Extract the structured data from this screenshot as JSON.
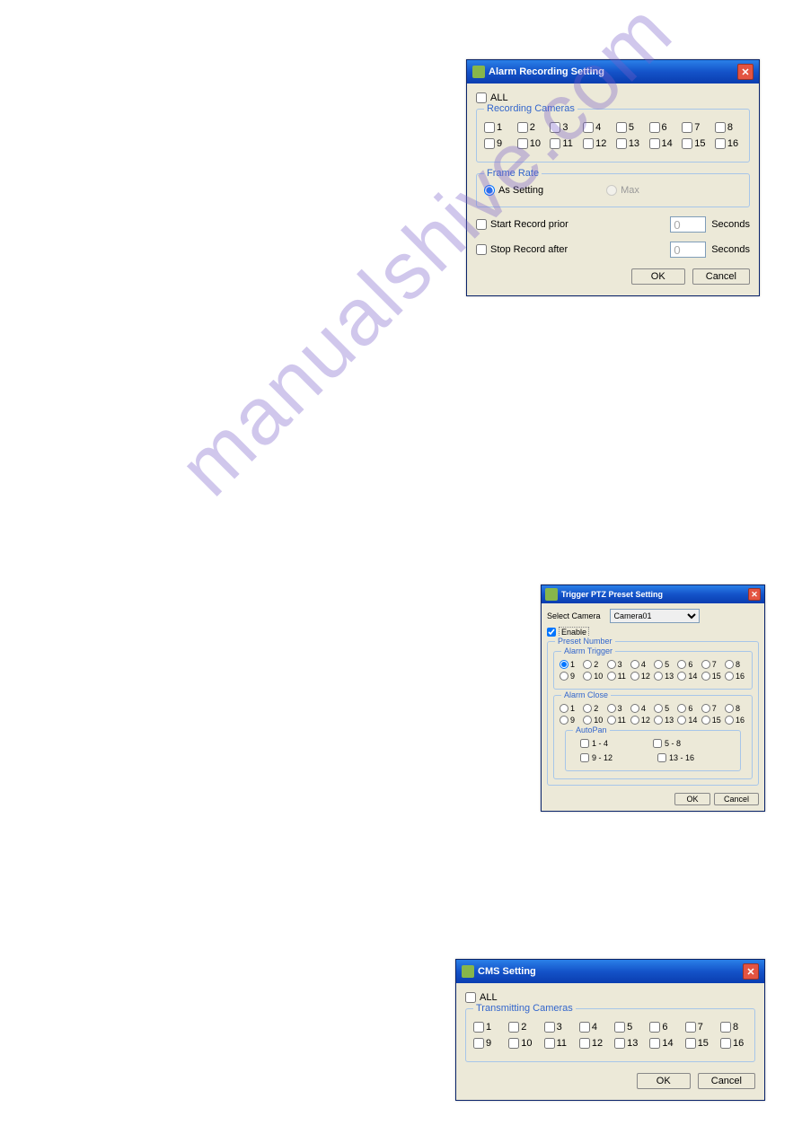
{
  "watermark": "manualshive.com",
  "dialog1": {
    "title": "Alarm Recording Setting",
    "all_label": "ALL",
    "fs_recording": "Recording Cameras",
    "cameras1": [
      "1",
      "2",
      "3",
      "4",
      "5",
      "6",
      "7",
      "8"
    ],
    "cameras2": [
      "9",
      "10",
      "11",
      "12",
      "13",
      "14",
      "15",
      "16"
    ],
    "fs_framerate": "Frame Rate",
    "opt_as_setting": "As Setting",
    "opt_max": "Max",
    "start_prior": "Start Record prior",
    "stop_after": "Stop Record after",
    "seconds": "Seconds",
    "num_default": "0",
    "ok": "OK",
    "cancel": "Cancel"
  },
  "dialog2": {
    "title": "Trigger PTZ Preset Setting",
    "select_camera": "Select Camera",
    "camera_value": "Camera01",
    "enable": "Enable",
    "fs_preset": "Preset Number",
    "fs_trigger": "Alarm Trigger",
    "fs_close": "Alarm Close",
    "fs_autopan": "AutoPan",
    "row1": [
      "1",
      "2",
      "3",
      "4",
      "5",
      "6",
      "7",
      "8"
    ],
    "row2": [
      "9",
      "10",
      "11",
      "12",
      "13",
      "14",
      "15",
      "16"
    ],
    "ap1": "1 - 4",
    "ap2": "5 - 8",
    "ap3": "9 - 12",
    "ap4": "13 - 16",
    "ok": "OK",
    "cancel": "Cancel"
  },
  "dialog3": {
    "title": "CMS Setting",
    "all_label": "ALL",
    "fs_transmitting": "Transmitting Cameras",
    "cameras1": [
      "1",
      "2",
      "3",
      "4",
      "5",
      "6",
      "7",
      "8"
    ],
    "cameras2": [
      "9",
      "10",
      "11",
      "12",
      "13",
      "14",
      "15",
      "16"
    ],
    "ok": "OK",
    "cancel": "Cancel"
  }
}
